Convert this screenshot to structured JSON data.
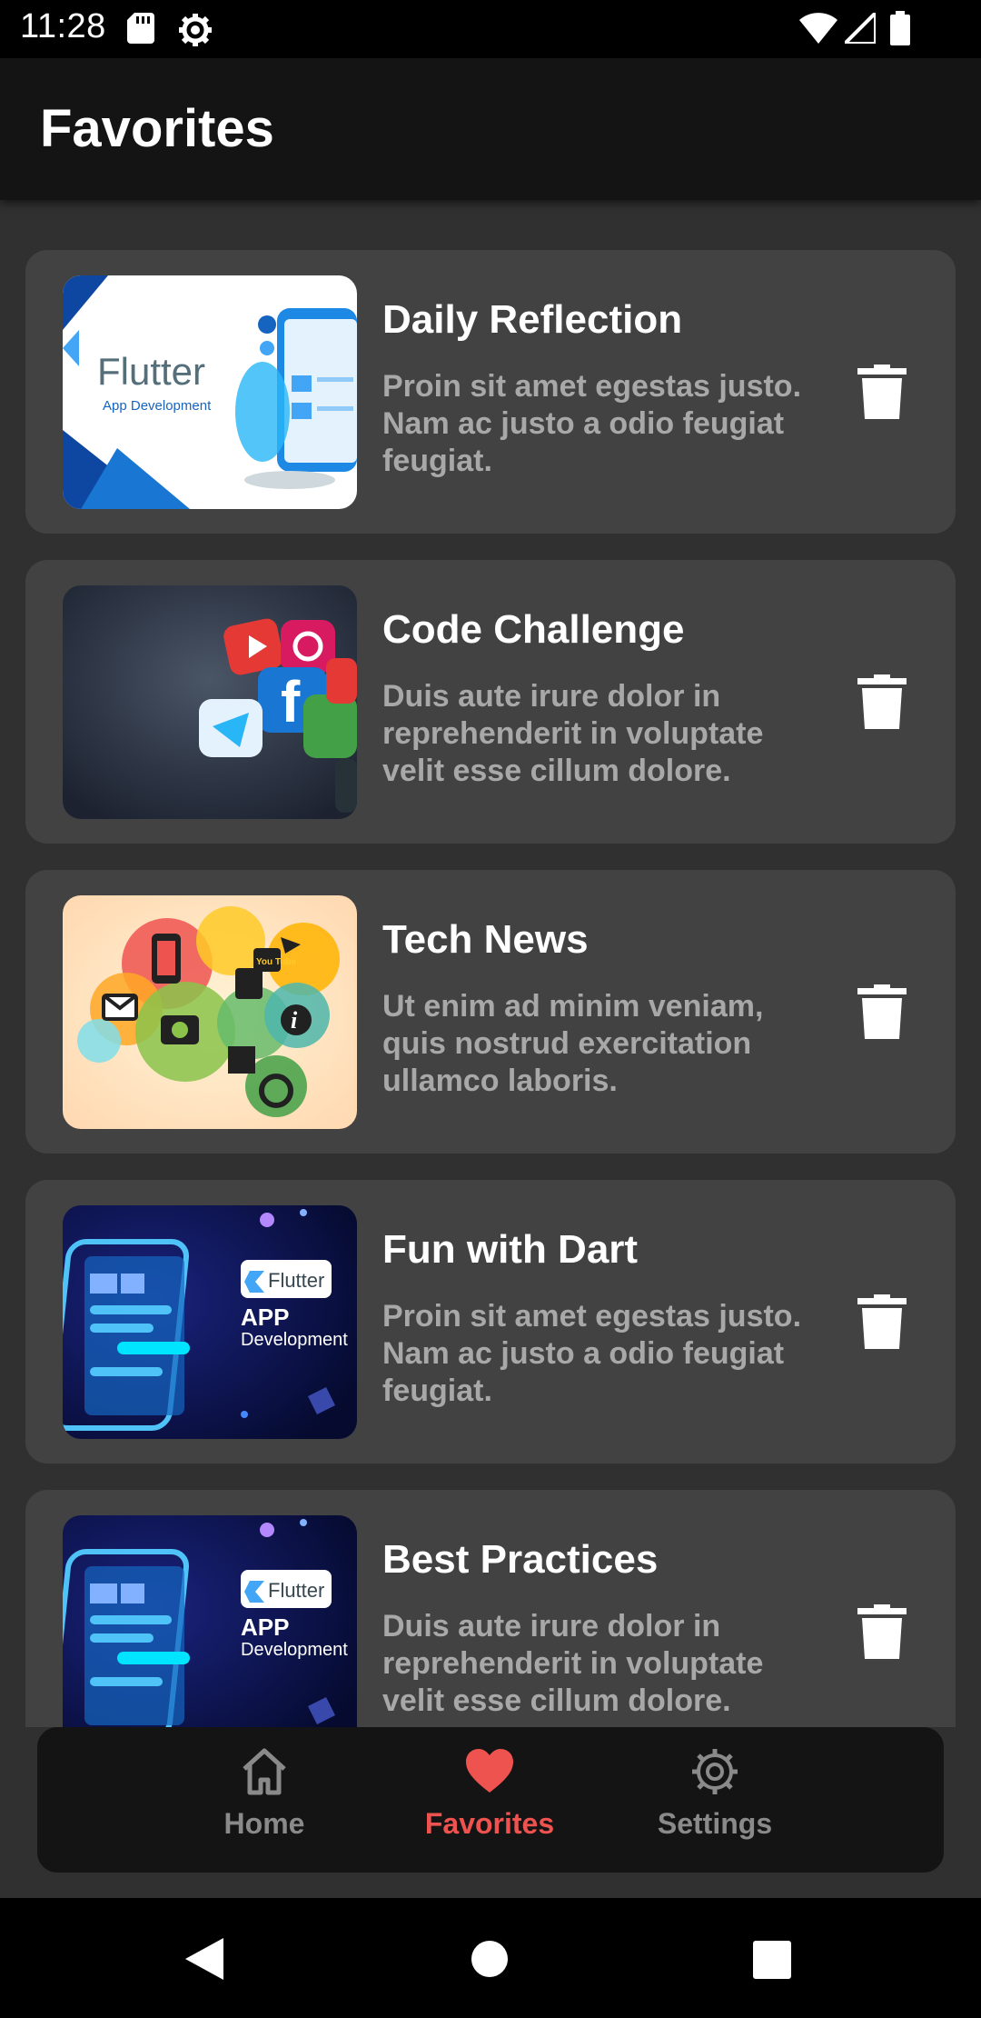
{
  "status_bar": {
    "time": "11:28",
    "icons": [
      "sd-card-icon",
      "settings-gear-icon",
      "wifi-icon",
      "cell-signal-icon",
      "battery-icon"
    ]
  },
  "app_bar": {
    "title": "Favorites"
  },
  "favorites": [
    {
      "title": "Daily Reflection",
      "description": "Proin sit amet egestas justo. Nam ac justo a odio feugiat feugiat.",
      "image_labels": [
        "Flutter",
        "App Development"
      ]
    },
    {
      "title": "Code Challenge",
      "description": "Duis aute irure dolor in reprehenderit in voluptate velit esse cillum dolore.",
      "image_labels": []
    },
    {
      "title": "Tech News",
      "description": "Ut enim ad minim veniam, quis nostrud exercitation ullamco laboris.",
      "image_labels": [
        "You Tube"
      ]
    },
    {
      "title": "Fun with Dart",
      "description": "Proin sit amet egestas justo. Nam ac justo a odio feugiat feugiat.",
      "image_labels": [
        "Flutter",
        "APP",
        "Development"
      ]
    },
    {
      "title": "Best Practices",
      "description": "Duis aute irure dolor in reprehenderit in voluptate velit esse cillum dolore.",
      "image_labels": [
        "Flutter",
        "APP",
        "Development"
      ]
    }
  ],
  "bottom_nav": {
    "items": [
      {
        "label": "Home",
        "icon": "home-icon",
        "active": false
      },
      {
        "label": "Favorites",
        "icon": "heart-icon",
        "active": true
      },
      {
        "label": "Settings",
        "icon": "settings-icon",
        "active": false
      }
    ]
  },
  "colors": {
    "background": "#303030",
    "card": "#424242",
    "app_bar": "#141414",
    "accent": "#ef5350",
    "inactive": "#8a8a8a"
  }
}
